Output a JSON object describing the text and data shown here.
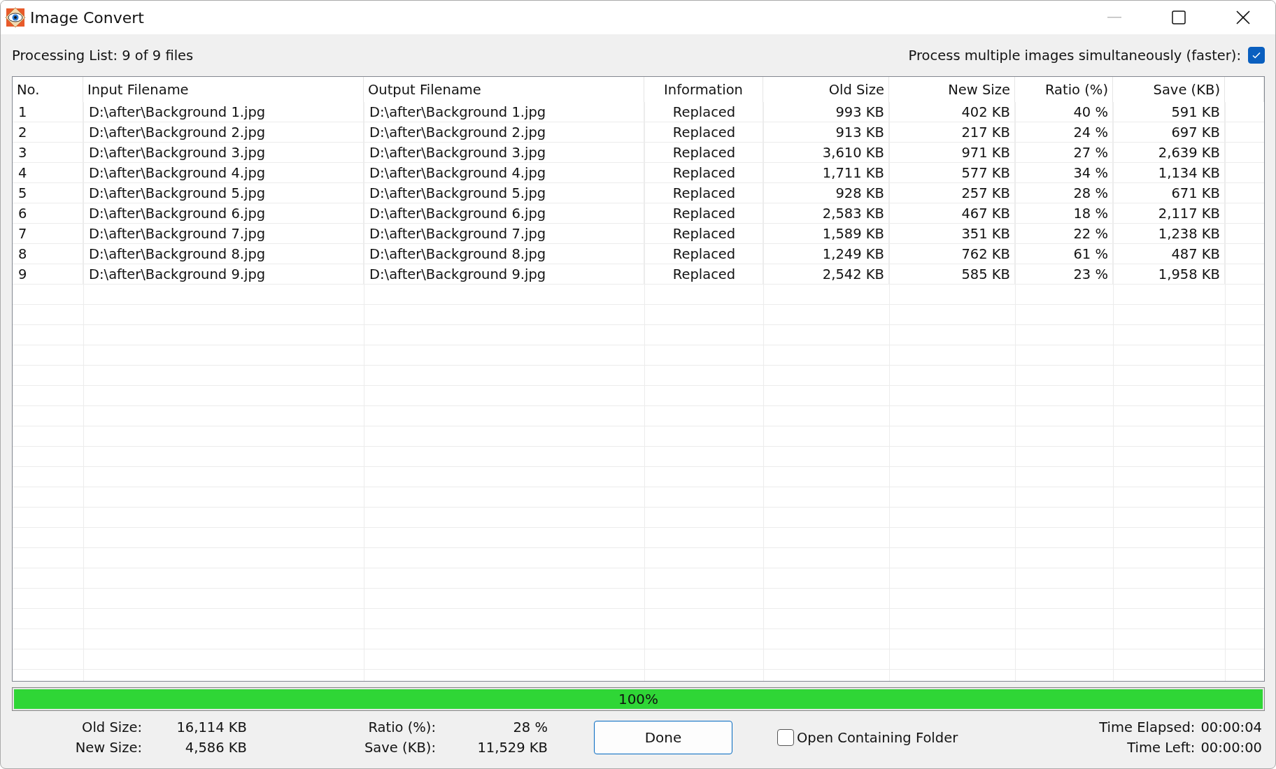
{
  "window": {
    "title": "Image Convert"
  },
  "processing_list": "Processing List: 9 of 9 files",
  "simultaneous": {
    "label": "Process multiple images simultaneously (faster):",
    "checked": true
  },
  "table": {
    "columns": [
      "No.",
      "Input Filename",
      "Output Filename",
      "Information",
      "Old Size",
      "New Size",
      "Ratio (%)",
      "Save (KB)"
    ],
    "rows": [
      [
        "1",
        "D:\\after\\Background 1.jpg",
        "D:\\after\\Background 1.jpg",
        "Replaced",
        "993 KB",
        "402 KB",
        "40 %",
        "591 KB"
      ],
      [
        "2",
        "D:\\after\\Background 2.jpg",
        "D:\\after\\Background 2.jpg",
        "Replaced",
        "913 KB",
        "217 KB",
        "24 %",
        "697 KB"
      ],
      [
        "3",
        "D:\\after\\Background 3.jpg",
        "D:\\after\\Background 3.jpg",
        "Replaced",
        "3,610 KB",
        "971 KB",
        "27 %",
        "2,639 KB"
      ],
      [
        "4",
        "D:\\after\\Background 4.jpg",
        "D:\\after\\Background 4.jpg",
        "Replaced",
        "1,711 KB",
        "577 KB",
        "34 %",
        "1,134 KB"
      ],
      [
        "5",
        "D:\\after\\Background 5.jpg",
        "D:\\after\\Background 5.jpg",
        "Replaced",
        "928 KB",
        "257 KB",
        "28 %",
        "671 KB"
      ],
      [
        "6",
        "D:\\after\\Background 6.jpg",
        "D:\\after\\Background 6.jpg",
        "Replaced",
        "2,583 KB",
        "467 KB",
        "18 %",
        "2,117 KB"
      ],
      [
        "7",
        "D:\\after\\Background 7.jpg",
        "D:\\after\\Background 7.jpg",
        "Replaced",
        "1,589 KB",
        "351 KB",
        "22 %",
        "1,238 KB"
      ],
      [
        "8",
        "D:\\after\\Background 8.jpg",
        "D:\\after\\Background 8.jpg",
        "Replaced",
        "1,249 KB",
        "762 KB",
        "61 %",
        "487 KB"
      ],
      [
        "9",
        "D:\\after\\Background 9.jpg",
        "D:\\after\\Background 9.jpg",
        "Replaced",
        "2,542 KB",
        "585 KB",
        "23 %",
        "1,958 KB"
      ]
    ]
  },
  "progress": {
    "level": 1,
    "text": "100%"
  },
  "summary": [
    {
      "label": "Old Size:",
      "value": "16,114 KB"
    },
    {
      "label": "New Size:",
      "value": "4,586 KB"
    },
    {
      "label": "Ratio (%):",
      "value": "28 %"
    },
    {
      "label": "Save (KB):",
      "value": "11,529 KB"
    }
  ],
  "done_button": "Done",
  "open_folder": {
    "label": "Open Containing Folder",
    "checked": false
  },
  "times": [
    {
      "label": "Time Elapsed:",
      "value": "00:00:04"
    },
    {
      "label": "Time Left:",
      "value": "00:00:00"
    }
  ]
}
